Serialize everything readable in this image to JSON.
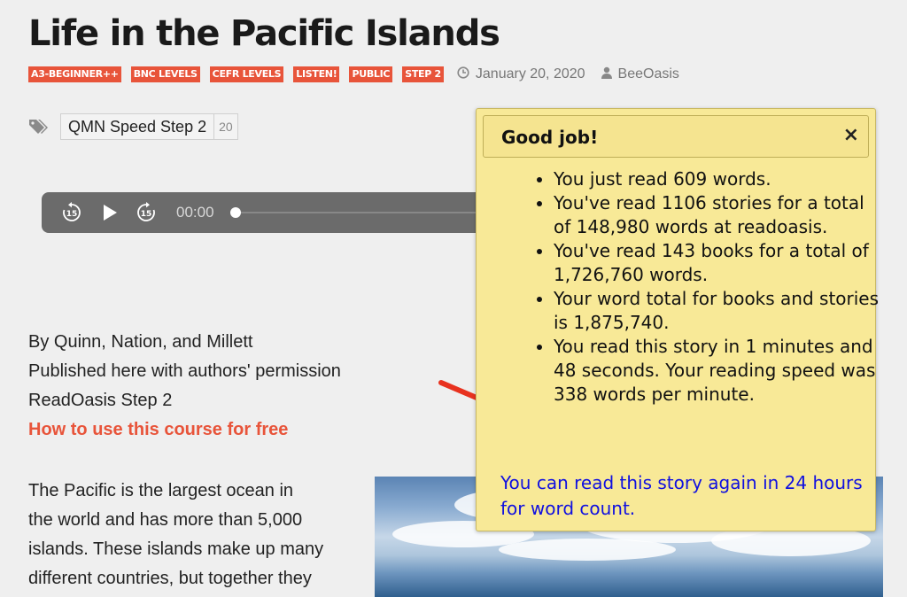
{
  "page": {
    "title": "Life in the Pacific Islands",
    "tags": [
      "A3-BEGINNER++",
      "BNC LEVELS",
      "CEFR LEVELS",
      "LISTEN!",
      "PUBLIC",
      "STEP 2"
    ],
    "date": "January 20, 2020",
    "author": "BeeOasis",
    "tag_box": {
      "name": "QMN Speed Step 2",
      "count": "20"
    }
  },
  "player": {
    "time": "00:00"
  },
  "byline": {
    "line1": "By Quinn, Nation, and Millett",
    "line2": "Published here with authors' permission",
    "line3": "ReadOasis Step 2",
    "link": "How to use this course for free"
  },
  "body": {
    "line1": "The Pacific is the largest ocean in",
    "line2": "the world and has more than 5,000",
    "line3": "islands. These islands make up many",
    "line4": "different countries, but together they"
  },
  "popup": {
    "title": "Good job!",
    "close": "×",
    "items": [
      "You just read 609 words.",
      "You've read 1106 stories for a total of 148,980 words at readoasis.",
      "You've read 143 books for a total of 1,726,760 words.",
      "Your word total for books and stories is 1,875,740.",
      "You read this story in 1 minutes and 48 seconds. Your reading speed was 338 words per minute."
    ],
    "again": "You can read this story again in 24 hours for word count."
  },
  "colors": {
    "accent": "#e8543a",
    "popup_bg": "#f8e997",
    "link_blue": "#1010e0",
    "arrow": "#e8321f"
  }
}
